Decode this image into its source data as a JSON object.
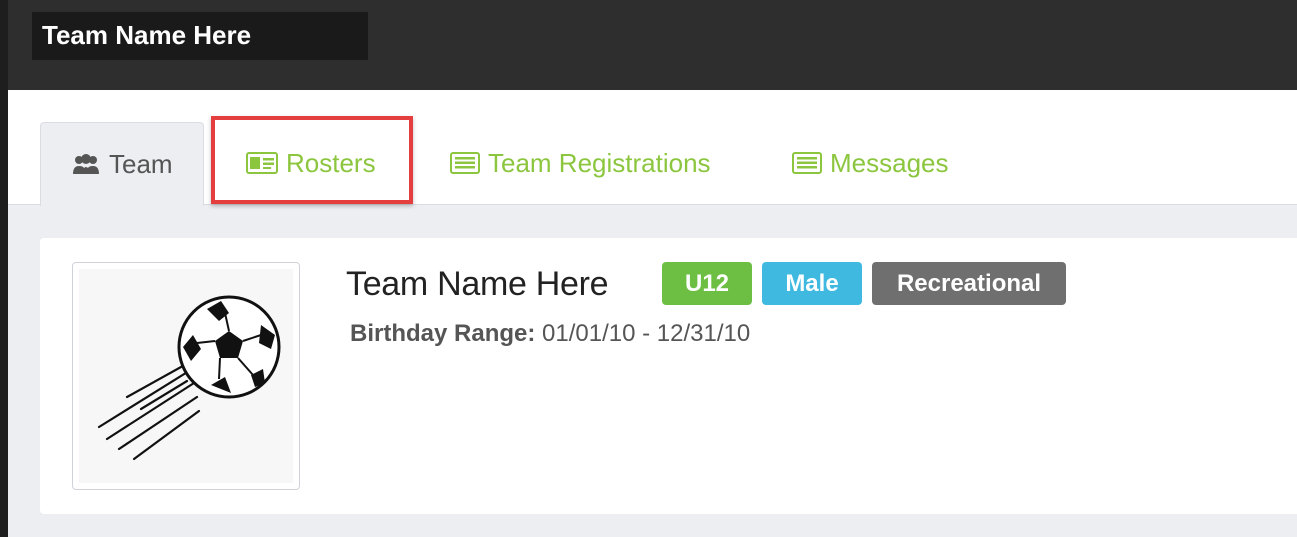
{
  "header": {
    "title": "Team Name Here"
  },
  "tabs": [
    {
      "label": "Team",
      "icon": "users-icon",
      "active": true
    },
    {
      "label": "Rosters",
      "icon": "id-card-icon",
      "active": false
    },
    {
      "label": "Team Registrations",
      "icon": "list-icon",
      "active": false
    },
    {
      "label": "Messages",
      "icon": "list-icon",
      "active": false
    }
  ],
  "team": {
    "name": "Team Name Here",
    "badges": [
      "U12",
      "Male",
      "Recreational"
    ],
    "birthday_label": "Birthday Range:",
    "birthday_value": "01/01/10 - 12/31/10",
    "logo": "soccer-ball-logo"
  },
  "colors": {
    "tab_link": "#8cc63f",
    "highlight": "#e53e3e",
    "badge_u12": "#6dbf44",
    "badge_male": "#3fb9df",
    "badge_recreational": "#6f6f6f"
  }
}
